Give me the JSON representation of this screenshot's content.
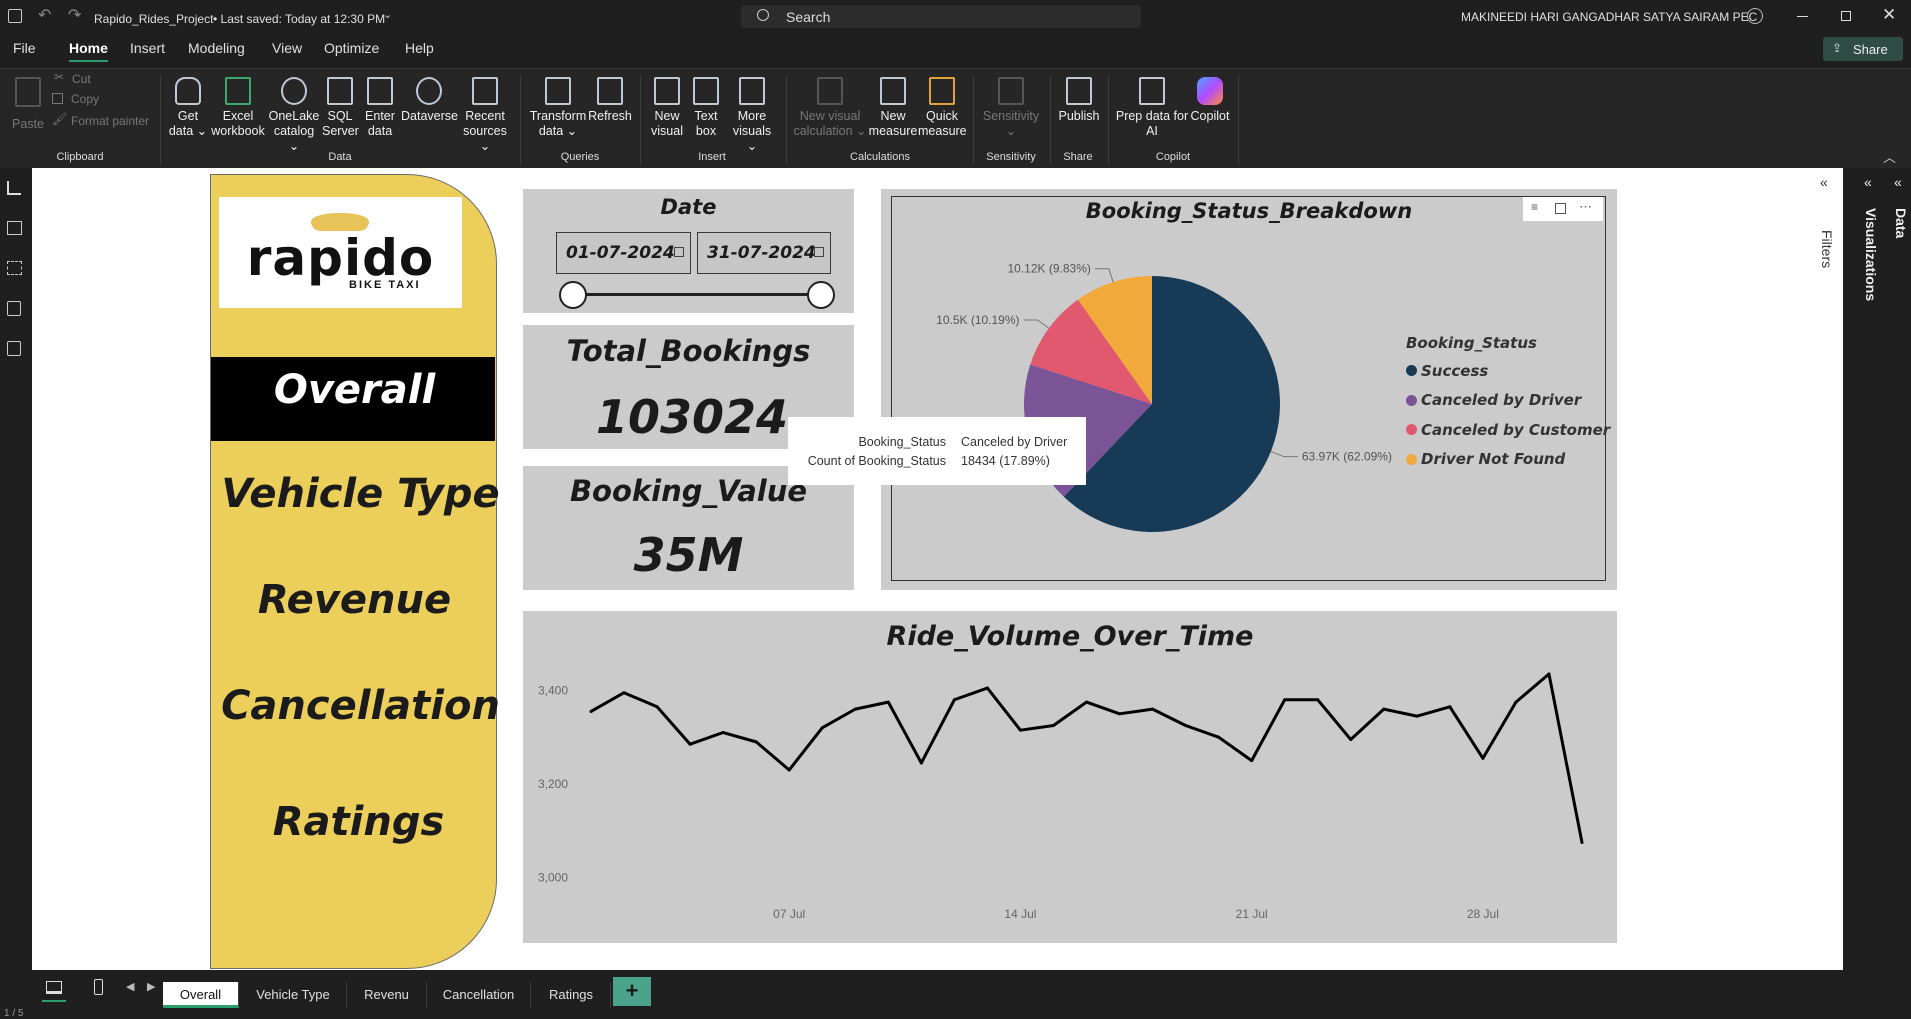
{
  "titlebar": {
    "doc_title": "Rapido_Rides_Project",
    "save_status": "• Last saved: Today at 12:30 PM",
    "search_placeholder": "Search",
    "user_name": "MAKINEEDI HARI GANGADHAR SATYA SAIRAM PEC"
  },
  "menu": {
    "items": [
      "File",
      "Home",
      "Insert",
      "Modeling",
      "View",
      "Optimize",
      "Help"
    ],
    "share_label": "Share"
  },
  "ribbon": {
    "clipboard": {
      "paste": "Paste",
      "cut": "Cut",
      "copy": "Copy",
      "format_painter": "Format painter",
      "group": "Clipboard"
    },
    "data": {
      "get_data": [
        "Get",
        "data ⌄"
      ],
      "excel": [
        "Excel",
        "workbook"
      ],
      "onelake": [
        "OneLake",
        "catalog ⌄"
      ],
      "sql": [
        "SQL",
        "Server"
      ],
      "enter": [
        "Enter",
        "data"
      ],
      "dataverse": [
        "Dataverse",
        ""
      ],
      "recent": [
        "Recent",
        "sources ⌄"
      ],
      "group": "Data"
    },
    "queries": {
      "transform": [
        "Transform",
        "data ⌄"
      ],
      "refresh": [
        "Refresh",
        ""
      ],
      "group": "Queries"
    },
    "insert": {
      "new_visual": [
        "New",
        "visual"
      ],
      "text_box": [
        "Text",
        "box"
      ],
      "more_visuals": [
        "More",
        "visuals ⌄"
      ],
      "group": "Insert"
    },
    "calculations": {
      "new_visual_calc": [
        "New visual",
        "calculation ⌄"
      ],
      "new_measure": [
        "New",
        "measure"
      ],
      "quick_measure": [
        "Quick",
        "measure"
      ],
      "group": "Calculations"
    },
    "sensitivity": {
      "label": [
        "Sensitivity",
        "⌄"
      ],
      "group": "Sensitivity"
    },
    "share": {
      "publish": [
        "Publish",
        ""
      ],
      "group": "Share"
    },
    "copilot": {
      "prep": [
        "Prep data for",
        "AI"
      ],
      "copilot": [
        "Copilot",
        ""
      ],
      "group": "Copilot"
    }
  },
  "nav": {
    "logo_text": "rapido",
    "logo_sub": "BIKE TAXI",
    "items": [
      "Overall",
      "Vehicle Type",
      "Revenue",
      "Cancellation",
      "Ratings"
    ]
  },
  "date_slicer": {
    "title": "Date",
    "start": "01-07-2024",
    "end": "31-07-2024",
    "start_pos": 0,
    "end_pos": 1
  },
  "kpi": {
    "total_bookings_title": "Total_Bookings",
    "total_bookings_value": "103024",
    "booking_value_title": "Booking_Value",
    "booking_value_value": "35M"
  },
  "pie": {
    "title": "Booking_Status_Breakdown",
    "legend_title": "Booking_Status",
    "tooltip": {
      "k1": "Booking_Status",
      "v1": "Canceled by Driver",
      "k2": "Count of Booking_Status",
      "v2": "18434 (17.89%)"
    }
  },
  "line": {
    "title": "Ride_Volume_Over_Time"
  },
  "chart_data": [
    {
      "type": "pie",
      "title": "Booking_Status_Breakdown",
      "legend_title": "Booking_Status",
      "slices": [
        {
          "name": "Success",
          "value": 63970,
          "label": "63.97K (62.09%)",
          "color": "#173a57"
        },
        {
          "name": "Canceled by Driver",
          "value": 18434,
          "label": "",
          "color": "#7a5496"
        },
        {
          "name": "Canceled by Customer",
          "value": 10500,
          "label": "10.5K (10.19%)",
          "color": "#e1596f"
        },
        {
          "name": "Driver Not Found",
          "value": 10120,
          "label": "10.12K (9.83%)",
          "color": "#f2a93b"
        }
      ]
    },
    {
      "type": "line",
      "title": "Ride_Volume_Over_Time",
      "x_ticks": [
        "07 Jul",
        "14 Jul",
        "21 Jul",
        "28 Jul"
      ],
      "y_ticks": [
        "3,400",
        "3,200",
        "3,000"
      ],
      "ylim": [
        2950,
        3450
      ],
      "x": [
        1,
        2,
        3,
        4,
        5,
        6,
        7,
        8,
        9,
        10,
        11,
        12,
        13,
        14,
        15,
        16,
        17,
        18,
        19,
        20,
        21,
        22,
        23,
        24,
        25,
        26,
        27,
        28,
        29,
        30,
        31
      ],
      "values": [
        3355,
        3395,
        3365,
        3285,
        3310,
        3290,
        3230,
        3320,
        3360,
        3375,
        3245,
        3380,
        3405,
        3315,
        3325,
        3375,
        3350,
        3360,
        3325,
        3300,
        3250,
        3380,
        3380,
        3295,
        3360,
        3345,
        3365,
        3255,
        3375,
        3435,
        3075
      ]
    }
  ],
  "pages": {
    "tabs": [
      "Overall",
      "Vehicle Type",
      "Revenu",
      "Cancellation",
      "Ratings"
    ],
    "active": "Overall",
    "add": "+"
  },
  "panes": {
    "filters": "Filters",
    "visualizations": "Visualizations",
    "data": "Data"
  }
}
